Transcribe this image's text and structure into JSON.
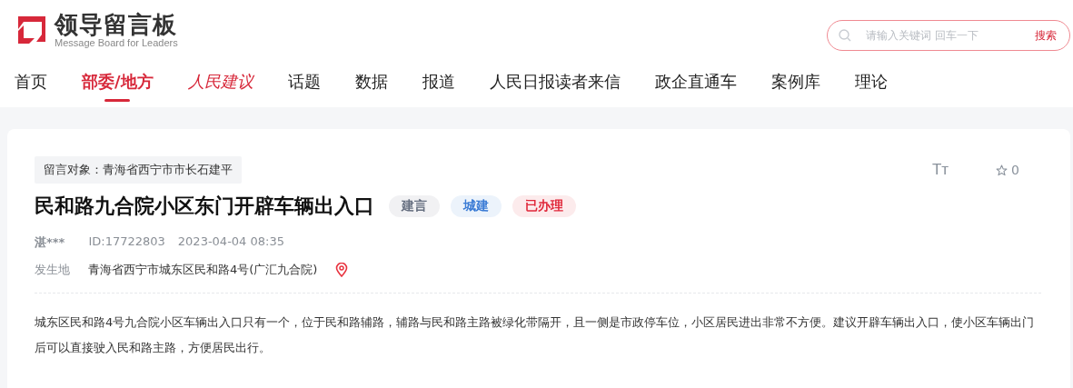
{
  "logo": {
    "title": "领导留言板",
    "subtitle": "Message Board for Leaders"
  },
  "search": {
    "placeholder": "请输入关键词 回车一下",
    "button": "搜索"
  },
  "nav": [
    {
      "label": "首页",
      "selected": false,
      "kind": "text"
    },
    {
      "label": "部委/地方",
      "selected": true,
      "kind": "text"
    },
    {
      "label": "人民建议",
      "selected": false,
      "kind": "brand"
    },
    {
      "label": "话题",
      "selected": false,
      "kind": "text"
    },
    {
      "label": "数据",
      "selected": false,
      "kind": "text"
    },
    {
      "label": "报道",
      "selected": false,
      "kind": "text"
    },
    {
      "label": "人民日报读者来信",
      "selected": false,
      "kind": "text"
    },
    {
      "label": "政企直通车",
      "selected": false,
      "kind": "text"
    },
    {
      "label": "案例库",
      "selected": false,
      "kind": "text"
    },
    {
      "label": "理论",
      "selected": false,
      "kind": "text"
    }
  ],
  "message": {
    "recipient": "留言对象：青海省西宁市市长石建平",
    "font_size_toggle": "Tт",
    "favorites": "0",
    "title": "民和路九合院小区东门开辟车辆出入口",
    "tags": [
      {
        "label": "建言",
        "color": "#666f80"
      },
      {
        "label": "城建",
        "color": "#3a7bd5"
      },
      {
        "label": "已办理",
        "color": "#e0283a"
      }
    ],
    "author": "湛***",
    "id": "ID:17722803",
    "time": "2023-04-04 08:35",
    "location_label": "发生地",
    "location": "青海省西宁市城东区民和路4号(广汇九合院)",
    "body": "城东区民和路4号九合院小区车辆出入口只有一个，位于民和路辅路，辅路与民和路主路被绿化带隔开，且一侧是市政停车位，小区居民进出非常不方便。建议开辟车辆出入口，使小区车辆出门后可以直接驶入民和路主路，方便居民出行。"
  }
}
